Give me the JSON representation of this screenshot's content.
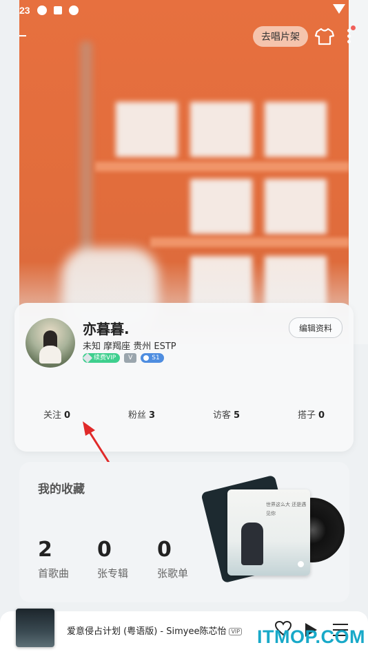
{
  "status_bar": {
    "time": "23"
  },
  "header": {
    "shelf_button": "去唱片架"
  },
  "profile": {
    "nickname": "亦暮暮.",
    "meta": "未知 摩羯座 贵州 ESTP",
    "badge_vip": "续费VIP",
    "badge_level": "S1",
    "edit_button": "编辑资料",
    "stats": [
      {
        "label": "关注",
        "value": "0"
      },
      {
        "label": "粉丝",
        "value": "3"
      },
      {
        "label": "访客",
        "value": "5"
      },
      {
        "label": "搭子",
        "value": "0"
      }
    ]
  },
  "collection": {
    "title": "我的收藏",
    "items": [
      {
        "count": "2",
        "label": "首歌曲"
      },
      {
        "count": "0",
        "label": "张专辑"
      },
      {
        "count": "0",
        "label": "张歌单"
      }
    ],
    "album_text": "世界这么大 还是遇见你"
  },
  "player": {
    "song": "爱意侵占计划 (粤语版) - Simyee陈芯怡",
    "vip_tag": "VIP"
  },
  "watermark": "ITMOP.COM",
  "colors": {
    "hero": "#e26d3c",
    "arrow": "#e02a2a",
    "watermark": "#18a9c8"
  }
}
